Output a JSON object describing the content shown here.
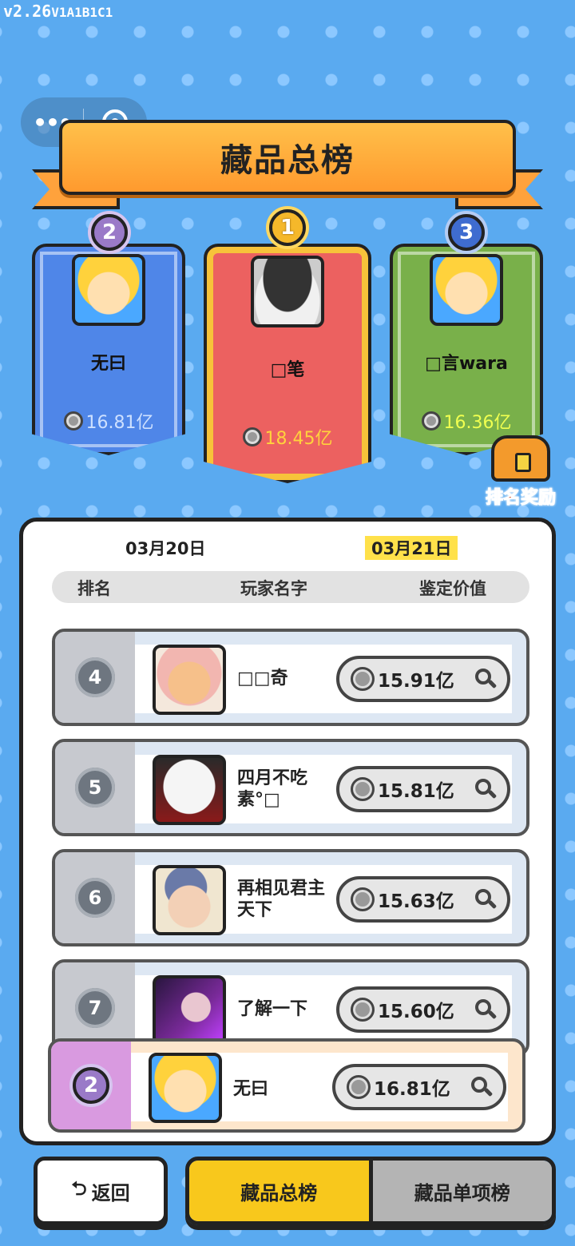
{
  "version": {
    "main": "v2.26",
    "build": "V1A1B1C1"
  },
  "capsule": {
    "more_icon": "more-dots-icon",
    "close_icon": "record-circle-icon"
  },
  "title": "藏品总榜",
  "podium": [
    {
      "rank": "2",
      "name": "无曰",
      "value": "16.81亿",
      "value_color": "#cde0ff"
    },
    {
      "rank": "1",
      "name": "□笔",
      "value": "18.45亿",
      "value_color": "#ffd23c"
    },
    {
      "rank": "3",
      "name": "□言wara",
      "value": "16.36亿",
      "value_color": "#f0ff50"
    }
  ],
  "reward_label": "排名奖励",
  "dates": {
    "prev": "03月20日",
    "current": "03月21日"
  },
  "table_header": {
    "rank": "排名",
    "player": "玩家名字",
    "value": "鉴定价值"
  },
  "rows": [
    {
      "rank": "4",
      "name": "□□奇",
      "value": "15.91亿"
    },
    {
      "rank": "5",
      "name": "四月不吃素°□",
      "value": "15.81亿"
    },
    {
      "rank": "6",
      "name": "再相见君主天下",
      "value": "15.63亿"
    },
    {
      "rank": "7",
      "name": "了解一下",
      "value": "15.60亿"
    }
  ],
  "self_row": {
    "rank": "2",
    "name": "无曰",
    "value": "16.81亿"
  },
  "bottom": {
    "back_label": "返回",
    "tab_total": "藏品总榜",
    "tab_single": "藏品单项榜"
  },
  "colors": {
    "background": "#5aaaf0",
    "banner": "#ffa23c",
    "active_tab": "#f8c81c",
    "date_highlight": "#ffe14a"
  }
}
